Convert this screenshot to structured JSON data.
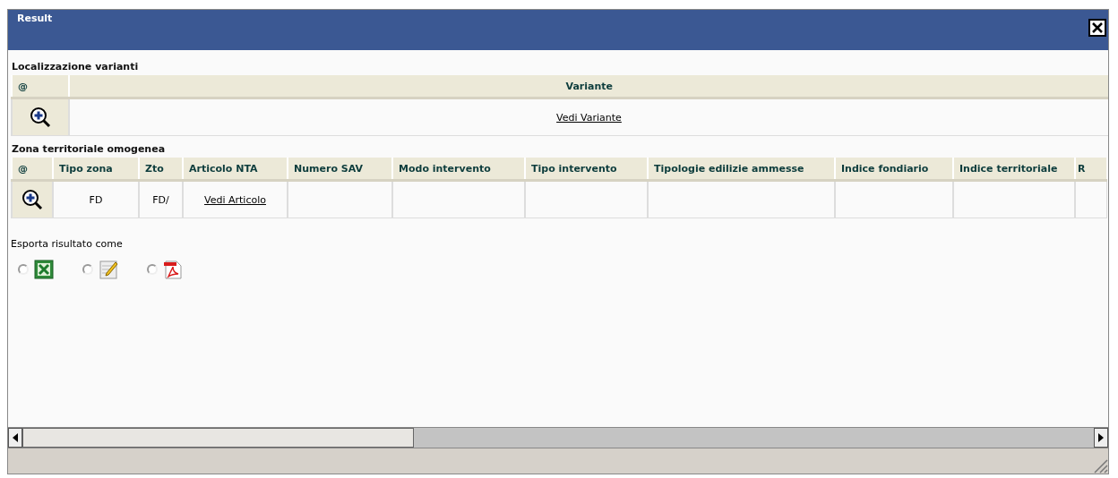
{
  "window": {
    "title": "Result"
  },
  "sections": [
    {
      "title": "Localizzazione varianti",
      "columns": [
        "@",
        "Variante"
      ],
      "rows": [
        {
          "cells": [
            {
              "kind": "zoom"
            },
            {
              "kind": "link",
              "text": "Vedi Variante"
            }
          ]
        }
      ]
    },
    {
      "title": "Zona territoriale omogenea",
      "columns": [
        "@",
        "Tipo zona",
        "Zto",
        "Articolo NTA",
        "Numero SAV",
        "Modo intervento",
        "Tipo intervento",
        "Tipologie edilizie ammesse",
        "Indice fondiario",
        "Indice territoriale",
        "R"
      ],
      "rows": [
        {
          "cells": [
            {
              "kind": "zoom"
            },
            {
              "kind": "text",
              "text": "FD"
            },
            {
              "kind": "text",
              "text": "FD/"
            },
            {
              "kind": "link",
              "text": "Vedi Articolo"
            },
            {
              "kind": "empty"
            },
            {
              "kind": "empty"
            },
            {
              "kind": "empty"
            },
            {
              "kind": "empty"
            },
            {
              "kind": "empty"
            },
            {
              "kind": "empty"
            },
            {
              "kind": "empty"
            }
          ]
        }
      ]
    }
  ],
  "export": {
    "label": "Esporta risultato come",
    "options": [
      {
        "kind": "excel",
        "selected": false
      },
      {
        "kind": "text",
        "selected": false
      },
      {
        "kind": "pdf",
        "selected": false
      }
    ]
  }
}
